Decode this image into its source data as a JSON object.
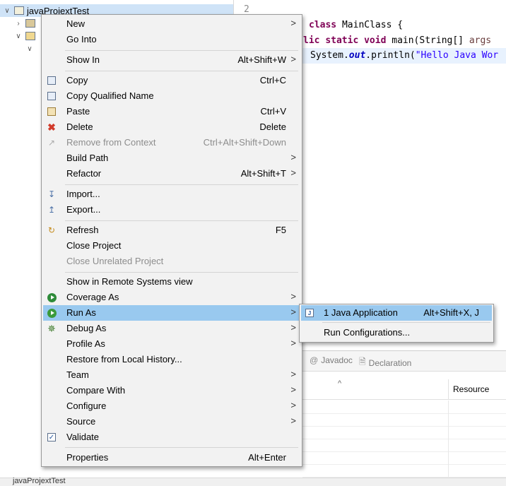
{
  "explorer": {
    "project_name": "javaProjextTest",
    "bottom_project_name": "javaProjextTest"
  },
  "editor": {
    "line_number": "2",
    "code_line1_kw": "class",
    "code_line1_rest": " MainClass {",
    "code_line2_kw1": "lic",
    "code_line2_kw2": "static",
    "code_line2_kw3": "void",
    "code_line2_rest": " main(String[] ",
    "code_line2_arg": "args",
    "code_line3_a": "System.",
    "code_line3_out": "out",
    "code_line3_b": ".println(",
    "code_line3_str": "\"Hello Java Wor"
  },
  "panel": {
    "tab_javadoc": "Javadoc",
    "tab_declaration": "Declaration",
    "col_resource": "Resource",
    "sort_caret": "^"
  },
  "context_menu": {
    "items": [
      {
        "label": "New",
        "submenu": true
      },
      {
        "label": "Go Into"
      },
      {
        "label": "Show In",
        "shortcut": "Alt+Shift+W",
        "submenu": true
      },
      {
        "label": "Copy",
        "shortcut": "Ctrl+C",
        "icon": "copy-icon"
      },
      {
        "label": "Copy Qualified Name",
        "icon": "copy-qualified-name-icon"
      },
      {
        "label": "Paste",
        "shortcut": "Ctrl+V",
        "icon": "paste-icon"
      },
      {
        "label": "Delete",
        "shortcut": "Delete",
        "icon": "delete-icon"
      },
      {
        "label": "Remove from Context",
        "shortcut": "Ctrl+Alt+Shift+Down",
        "disabled": true,
        "icon": "remove-from-context-icon"
      },
      {
        "label": "Build Path",
        "submenu": true
      },
      {
        "label": "Refactor",
        "shortcut": "Alt+Shift+T",
        "submenu": true
      },
      {
        "label": "Import...",
        "icon": "import-icon"
      },
      {
        "label": "Export...",
        "icon": "export-icon"
      },
      {
        "label": "Refresh",
        "shortcut": "F5",
        "icon": "refresh-icon"
      },
      {
        "label": "Close Project"
      },
      {
        "label": "Close Unrelated Project",
        "disabled": true
      },
      {
        "label": "Show in Remote Systems view"
      },
      {
        "label": "Coverage As",
        "submenu": true,
        "icon": "coverage-icon"
      },
      {
        "label": "Run As",
        "submenu": true,
        "active": true,
        "icon": "run-icon"
      },
      {
        "label": "Debug As",
        "submenu": true,
        "icon": "debug-bug-icon"
      },
      {
        "label": "Profile As",
        "submenu": true
      },
      {
        "label": "Restore from Local History..."
      },
      {
        "label": "Team",
        "submenu": true
      },
      {
        "label": "Compare With",
        "submenu": true
      },
      {
        "label": "Configure",
        "submenu": true
      },
      {
        "label": "Source",
        "submenu": true
      },
      {
        "label": "Validate",
        "icon": "validate-checkbox-icon"
      },
      {
        "label": "Properties",
        "shortcut": "Alt+Enter"
      }
    ],
    "arrow_glyph": ">"
  },
  "run_as_submenu": {
    "items": [
      {
        "label": "1 Java Application",
        "shortcut": "Alt+Shift+X, J",
        "icon": "java-application-icon",
        "active": true
      },
      {
        "label": "Run Configurations..."
      }
    ]
  },
  "colors": {
    "menu_bg": "#f2f2f2",
    "menu_highlight": "#99c9ef",
    "keyword": "#7f0055",
    "string": "#2a00ff"
  }
}
